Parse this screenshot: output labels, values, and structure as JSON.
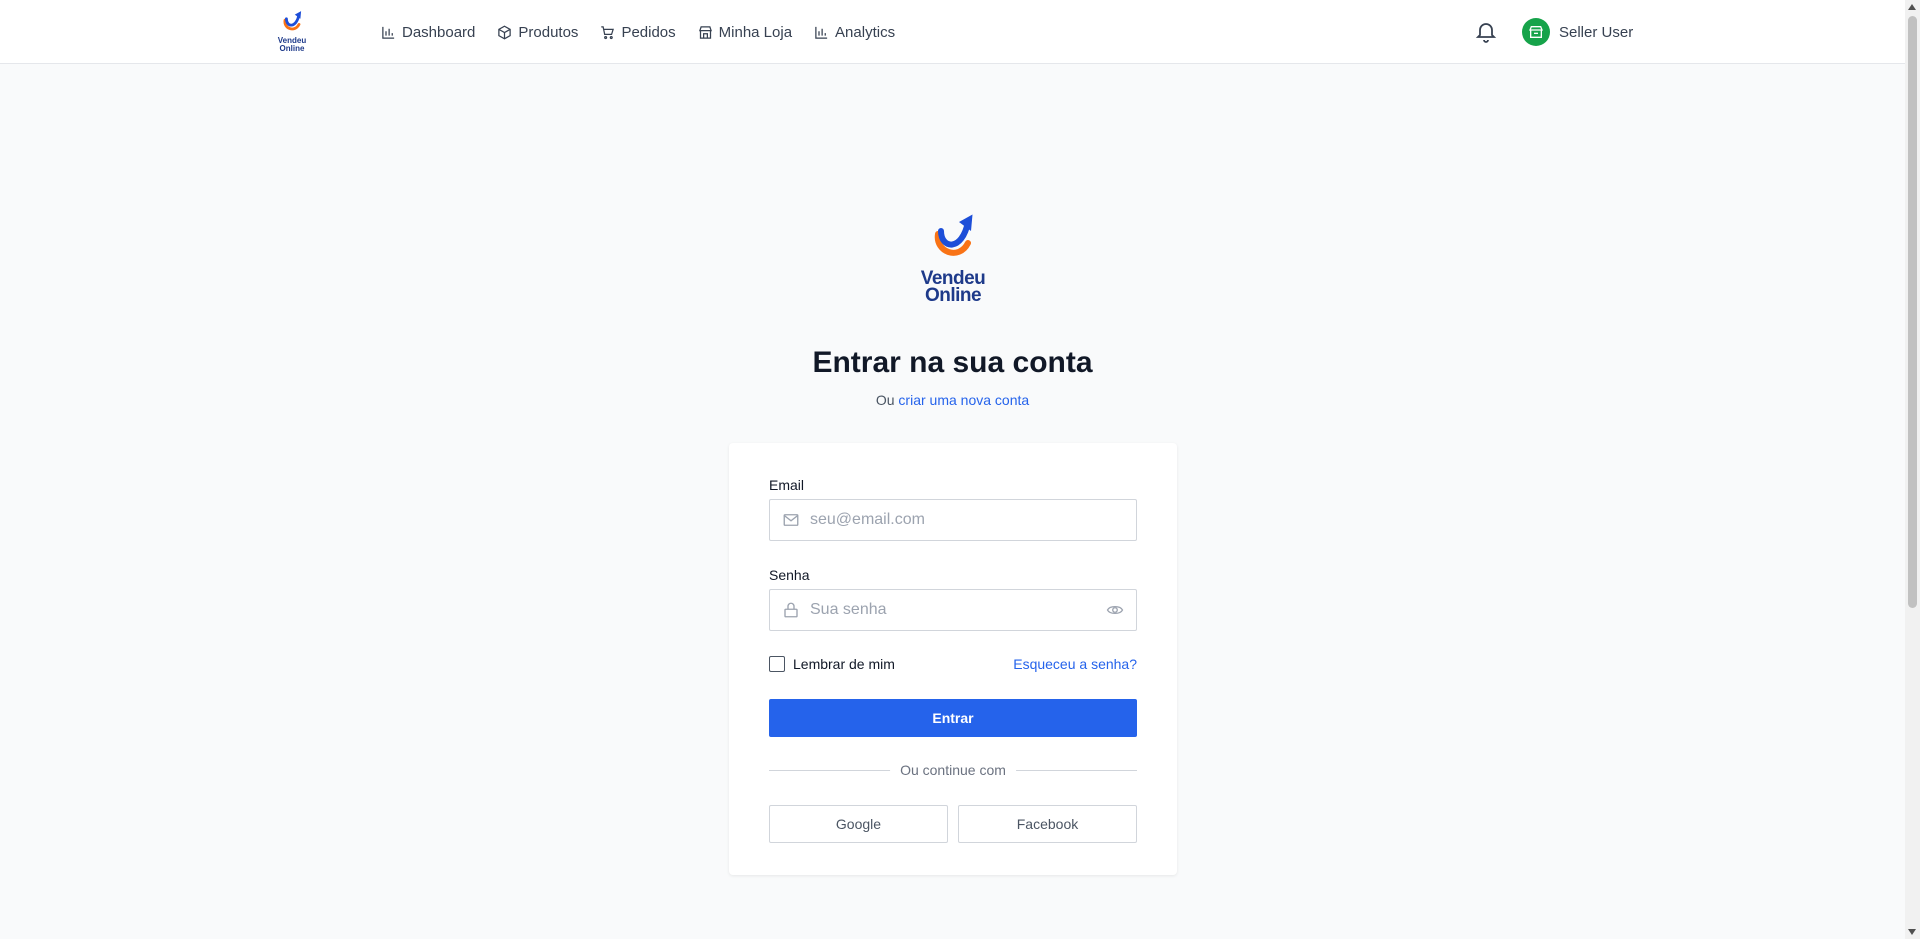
{
  "header": {
    "brand": {
      "line1": "Vendeu",
      "line2": "Online"
    },
    "nav": [
      {
        "label": "Dashboard",
        "icon": "bar-chart-icon"
      },
      {
        "label": "Produtos",
        "icon": "package-icon"
      },
      {
        "label": "Pedidos",
        "icon": "cart-icon"
      },
      {
        "label": "Minha Loja",
        "icon": "store-icon"
      },
      {
        "label": "Analytics",
        "icon": "bar-chart-icon"
      }
    ],
    "user_name": "Seller User",
    "avatar_color": "#16a34a"
  },
  "login": {
    "logo": {
      "line1": "Vendeu",
      "line2": "Online"
    },
    "title": "Entrar na sua conta",
    "subtitle_prefix": "Ou",
    "subtitle_link": "criar uma nova conta",
    "email_label": "Email",
    "email_placeholder": "seu@email.com",
    "email_value": "",
    "password_label": "Senha",
    "password_placeholder": "Sua senha",
    "password_value": "",
    "remember_label": "Lembrar de mim",
    "remember_checked": false,
    "forgot_label": "Esqueceu a senha?",
    "submit_label": "Entrar",
    "divider_text": "Ou continue com",
    "google_label": "Google",
    "facebook_label": "Facebook",
    "primary_color": "#2563eb"
  }
}
